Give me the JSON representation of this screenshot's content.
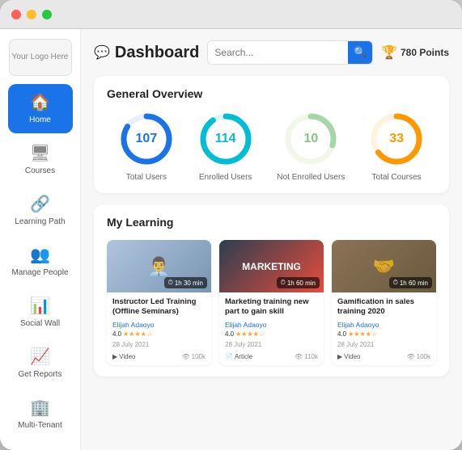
{
  "window": {
    "titlebar": {
      "dots": [
        "red",
        "yellow",
        "green"
      ]
    }
  },
  "sidebar": {
    "logo": "Your Logo Here",
    "items": [
      {
        "id": "home",
        "label": "Home",
        "icon": "🏠",
        "active": true
      },
      {
        "id": "courses",
        "label": "Courses",
        "icon": "🖥",
        "active": false
      },
      {
        "id": "learning-path",
        "label": "Learning Path",
        "icon": "🔗",
        "active": false
      },
      {
        "id": "manage-people",
        "label": "Manage People",
        "icon": "👥",
        "active": false
      },
      {
        "id": "social-wall",
        "label": "Social Wall",
        "icon": "📊",
        "active": false
      },
      {
        "id": "get-reports",
        "label": "Get Reports",
        "icon": "📈",
        "active": false
      },
      {
        "id": "multi-tenant",
        "label": "Multi-Tenant",
        "icon": "🏢",
        "active": false
      }
    ]
  },
  "header": {
    "title": "Dashboard",
    "search_placeholder": "Search...",
    "points": "780 Points"
  },
  "overview": {
    "title": "General Overview",
    "stats": [
      {
        "value": "107",
        "label": "Total Users",
        "color": "#1a73e8",
        "pct": 85,
        "bg": "#e8f0fe"
      },
      {
        "value": "114",
        "label": "Enrolled Users",
        "color": "#00bcd4",
        "pct": 90,
        "bg": "#e0f7fa"
      },
      {
        "value": "10",
        "label": "Not Enrolled Users",
        "color": "#c8e6c9",
        "pct": 30,
        "bg": "#f1f8e9"
      },
      {
        "value": "33",
        "label": "Total Courses",
        "color": "#ff9800",
        "pct": 65,
        "bg": "#fff3e0"
      }
    ]
  },
  "my_learning": {
    "title": "My Learning",
    "courses": [
      {
        "title": "Instructor Led Training (Offline Seminars)",
        "author": "Elijah Adaoyo",
        "rating": "4.0",
        "date": "28 July 2021",
        "duration": "1h 30 min",
        "type": "Video",
        "views": "100k",
        "thumb_class": "thumb-1"
      },
      {
        "title": "Marketing training new part to gain skill",
        "author": "Elijah Adaoyo",
        "rating": "4.0",
        "date": "28 July 2021",
        "duration": "1h 60 min",
        "type": "Article",
        "views": "110k",
        "thumb_class": "thumb-2"
      },
      {
        "title": "Gamification in sales training 2020",
        "author": "Elijah Adaoyo",
        "rating": "4.0",
        "date": "28 July 2021",
        "duration": "1h 60 min",
        "type": "Video",
        "views": "100k",
        "thumb_class": "thumb-3"
      }
    ]
  }
}
